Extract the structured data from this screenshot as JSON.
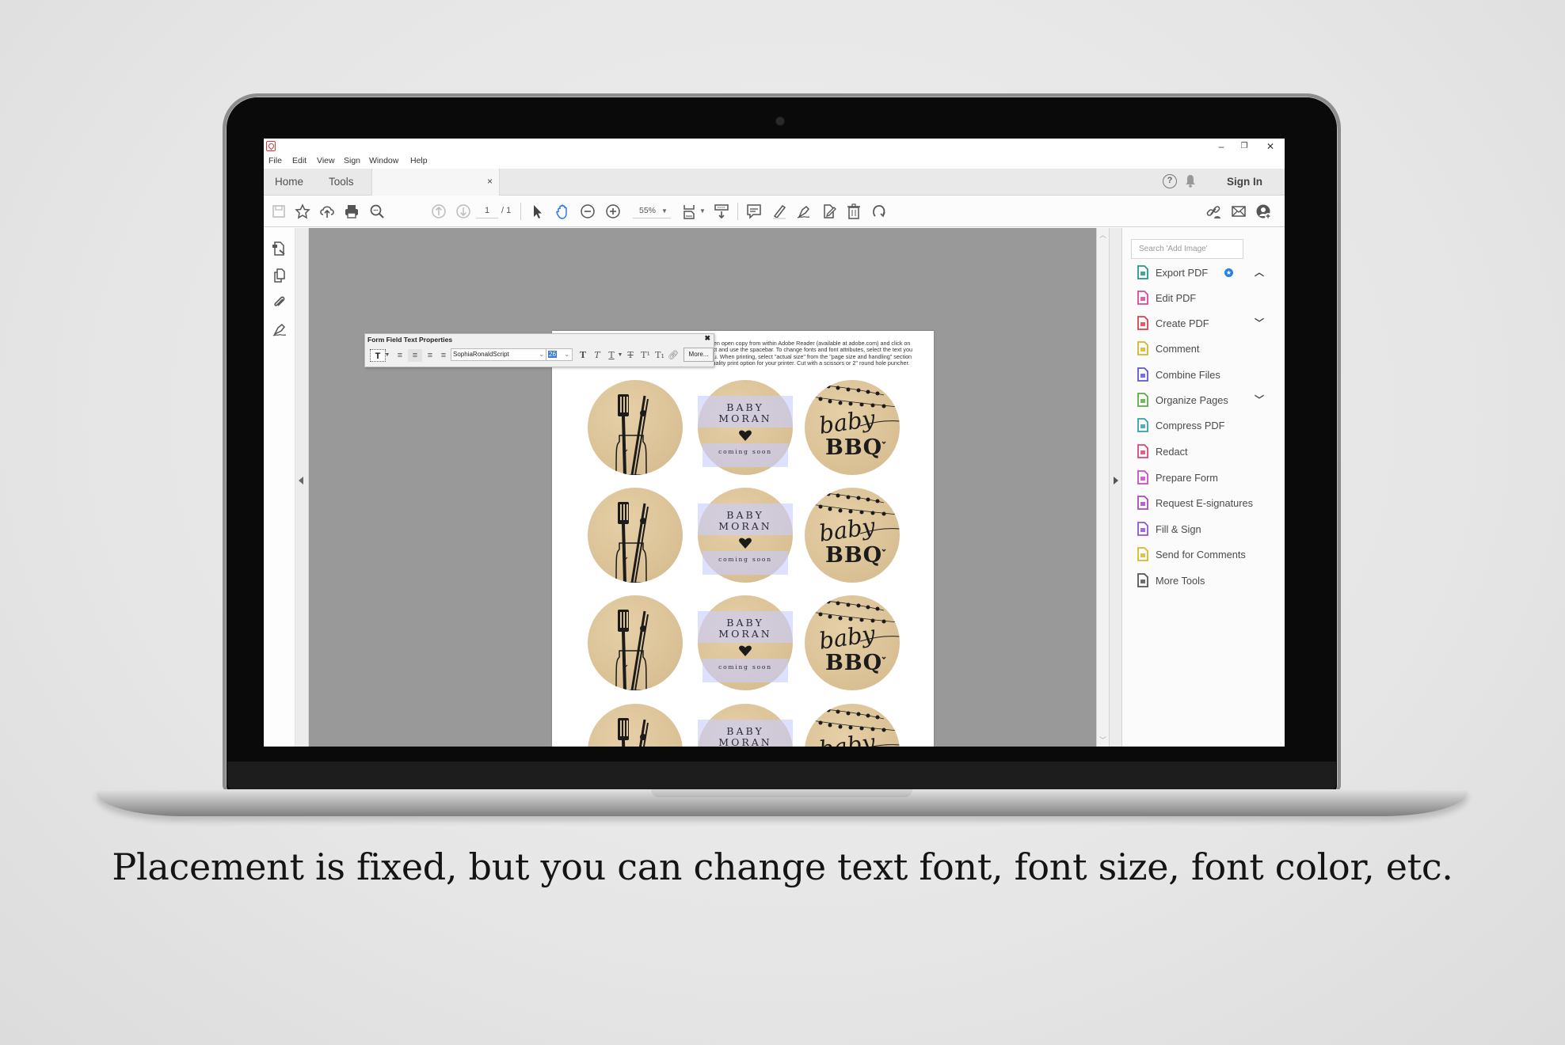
{
  "caption": "Placement is fixed, but you can change text font, font size, font color, etc.",
  "window": {
    "controls": {
      "minimize": "–",
      "restore": "❐",
      "close": "✕"
    }
  },
  "menu": [
    "File",
    "Edit",
    "View",
    "Sign",
    "Window",
    "Help"
  ],
  "tabs": {
    "home": "Home",
    "tools": "Tools",
    "doc_close": "×"
  },
  "header_right": {
    "help": "?",
    "sign_in": "Sign In"
  },
  "toolbar": {
    "page_current": "1",
    "page_total": "/ 1",
    "zoom": "55%",
    "icons": [
      "save-icon",
      "bookmark-star-icon",
      "upload-cloud-icon",
      "print-icon",
      "find-icon",
      "prev-page-icon",
      "next-page-icon",
      "select-arrow-icon",
      "hand-icon",
      "zoom-out-icon",
      "zoom-in-icon",
      "fit-page-icon",
      "scroll-mode-icon",
      "comment-icon",
      "highlight-icon",
      "sign-icon",
      "share-doc-icon",
      "delete-icon",
      "rotate-icon",
      "share-link-icon",
      "email-icon",
      "add-user-icon"
    ]
  },
  "form_props": {
    "title": "Form Field Text Properties",
    "close": "✖",
    "font": "SophiaRonaldScript",
    "size": "26",
    "more": "More..."
  },
  "document": {
    "instructions": "IMPORTANT: Download this file to your desktop and then open copy from within Adobe Reader (available at adobe.com) and click on the highlighted area and start typing. To space select text and use the spacebar. To change fonts and font attributes, select the text you would like to change and use the properties dialog menu. When printing, select \"actual size\" from the \"page size and handling\" section of reader's print dialogue and choose the better/best quality print option for your printer. Cut with a scissors or 2\" round hole puncher.",
    "rows": 4,
    "sticker_name_line1": "BABY",
    "sticker_name_line2": "MORAN",
    "sticker_sub": "coming soon",
    "bbq_script": "baby",
    "bbq_bold": "BBQ"
  },
  "right_panel": {
    "search_placeholder": "Search 'Add Image'",
    "items": [
      {
        "label": "Export PDF",
        "icon": "export-pdf-icon",
        "color": "#26978b",
        "chevron": "^",
        "badge": true
      },
      {
        "label": "Edit PDF",
        "icon": "edit-pdf-icon",
        "color": "#d9469d",
        "chevron": ""
      },
      {
        "label": "Create PDF",
        "icon": "create-pdf-icon",
        "color": "#d9424c",
        "chevron": "v"
      },
      {
        "label": "Comment",
        "icon": "comment-icon",
        "color": "#d6b528",
        "chevron": ""
      },
      {
        "label": "Combine Files",
        "icon": "combine-files-icon",
        "color": "#5b58d6",
        "chevron": ""
      },
      {
        "label": "Organize Pages",
        "icon": "organize-pages-icon",
        "color": "#5cab48",
        "chevron": "v"
      },
      {
        "label": "Compress PDF",
        "icon": "compress-pdf-icon",
        "color": "#31a3a8",
        "chevron": ""
      },
      {
        "label": "Redact",
        "icon": "redact-icon",
        "color": "#dc4574",
        "chevron": ""
      },
      {
        "label": "Prepare Form",
        "icon": "prepare-form-icon",
        "color": "#c44ec4",
        "chevron": ""
      },
      {
        "label": "Request E-signatures",
        "icon": "request-esign-icon",
        "color": "#a64bb8",
        "chevron": ""
      },
      {
        "label": "Fill & Sign",
        "icon": "fill-sign-icon",
        "color": "#8d55d2",
        "chevron": ""
      },
      {
        "label": "Send for Comments",
        "icon": "send-comments-icon",
        "color": "#d8b92a",
        "chevron": ""
      },
      {
        "label": "More Tools",
        "icon": "more-tools-icon",
        "color": "#555555",
        "chevron": ""
      }
    ]
  }
}
